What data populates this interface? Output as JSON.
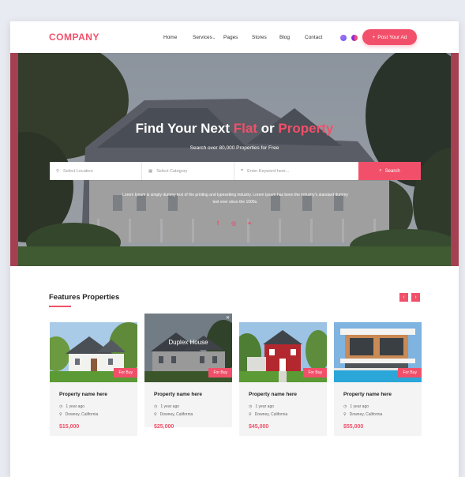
{
  "header": {
    "logo": "COMPANY",
    "nav": [
      "Home",
      "Services",
      "Pages",
      "Stores",
      "Blog",
      "Contact"
    ],
    "post_ad": "Post Your Ad"
  },
  "hero": {
    "title_part1": "Find Your Next ",
    "title_accent1": "Flat",
    "title_part2": " or ",
    "title_accent2": "Property",
    "subtitle": "Search over 80,000 Properties for Free",
    "search": {
      "location_placeholder": "Select Location",
      "category_placeholder": "Select Category",
      "keyword_placeholder": "Enter Keyword here...",
      "button": "Search"
    },
    "description": "Lorem Ipsum is simply dummy text of the printing and typesetting industry. Lorem Ipsum has been the industry's standard dummy text ever since the 1500s.",
    "socials": [
      "facebook-icon",
      "instagram-icon",
      "twitter-icon"
    ]
  },
  "features": {
    "title": "Features Properties",
    "cards": [
      {
        "name": "Property name here",
        "time": "1 year ago",
        "location": "Downey, California",
        "price": "$15,000",
        "badge": "For Buy"
      },
      {
        "name": "Property name here",
        "time": "1 year ago",
        "location": "Downey, California",
        "price": "$25,000",
        "badge": "For Buy",
        "overlay": "Duplex House"
      },
      {
        "name": "Property name here",
        "time": "1 year ago",
        "location": "Downey, California",
        "price": "$45,000",
        "badge": "For Buy"
      },
      {
        "name": "Property name here",
        "time": "1 year ago",
        "location": "Downey, California",
        "price": "$55,000",
        "badge": "For Buy"
      }
    ]
  },
  "colors": {
    "accent": "#f2506a",
    "background": "#e9ebf2"
  }
}
